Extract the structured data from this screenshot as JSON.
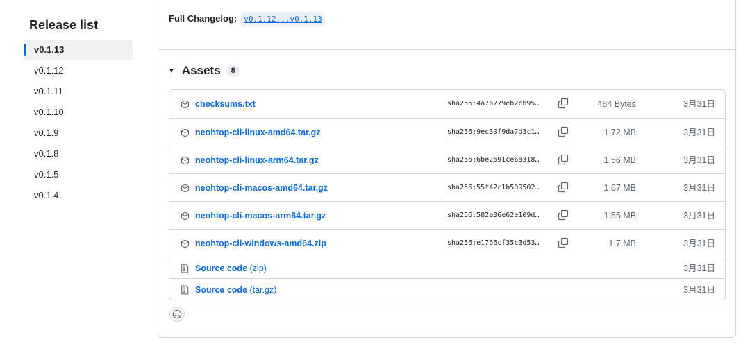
{
  "sidebar": {
    "title": "Release list",
    "items": [
      {
        "label": "v0.1.13",
        "active": true
      },
      {
        "label": "v0.1.12"
      },
      {
        "label": "v0.1.11"
      },
      {
        "label": "v0.1.10"
      },
      {
        "label": "v0.1.9"
      },
      {
        "label": "v0.1.8"
      },
      {
        "label": "v0.1.5"
      },
      {
        "label": "v0.1.4"
      }
    ]
  },
  "changelog": {
    "label": "Full Changelog:",
    "link": "v0.1.12...v0.1.13"
  },
  "assets": {
    "title": "Assets",
    "count": "8",
    "rows": [
      {
        "icon": "package-icon",
        "name": "checksums.txt",
        "sha": "sha256:4a7b779eb2cb95…",
        "size": "484 Bytes",
        "date": "3月31日"
      },
      {
        "icon": "package-icon",
        "name": "neohtop-cli-linux-amd64.tar.gz",
        "sha": "sha256:9ec30f9da7d3c1…",
        "size": "1.72 MB",
        "date": "3月31日"
      },
      {
        "icon": "package-icon",
        "name": "neohtop-cli-linux-arm64.tar.gz",
        "sha": "sha256:6be2691ce6a318…",
        "size": "1.56 MB",
        "date": "3月31日"
      },
      {
        "icon": "package-icon",
        "name": "neohtop-cli-macos-amd64.tar.gz",
        "sha": "sha256:55f42c1b509502…",
        "size": "1.67 MB",
        "date": "3月31日"
      },
      {
        "icon": "package-icon",
        "name": "neohtop-cli-macos-arm64.tar.gz",
        "sha": "sha256:582a36e62e109d…",
        "size": "1.55 MB",
        "date": "3月31日"
      },
      {
        "icon": "package-icon",
        "name": "neohtop-cli-windows-amd64.zip",
        "sha": "sha256:e1766cf35c3d53…",
        "size": "1.7 MB",
        "date": "3月31日"
      },
      {
        "icon": "file-zip-icon",
        "name": "Source code",
        "suffix": " (zip)",
        "date": "3月31日"
      },
      {
        "icon": "file-zip-icon",
        "name": "Source code",
        "suffix": " (tar.gz)",
        "date": "3月31日"
      }
    ]
  },
  "reaction": {
    "icon": "smiley-icon"
  },
  "colors": {
    "link": "#0969da",
    "active_indicator": "#0969da",
    "border": "#d1d9e0"
  }
}
